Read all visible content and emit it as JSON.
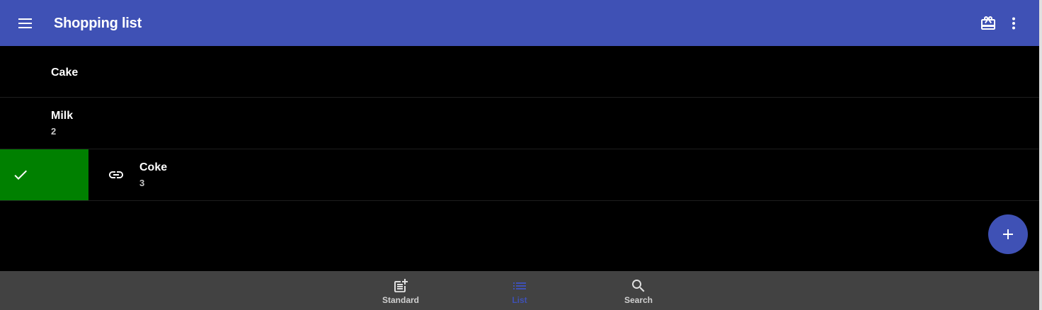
{
  "appbar": {
    "title": "Shopping list",
    "menu_icon": "menu-icon",
    "gift_icon": "redeem-icon",
    "more_icon": "more-vert-icon"
  },
  "items": [
    {
      "name": "Cake",
      "quantity": ""
    },
    {
      "name": "Milk",
      "quantity": "2"
    },
    {
      "name": "Coke",
      "quantity": "3",
      "icon": "link-icon",
      "swipe_action": "check-icon"
    }
  ],
  "bottom_nav": [
    {
      "label": "Standard",
      "icon": "post-add-icon",
      "active": false
    },
    {
      "label": "List",
      "icon": "list-icon",
      "active": true
    },
    {
      "label": "Search",
      "icon": "search-icon",
      "active": false
    }
  ],
  "colors": {
    "primary": "#3f51b5",
    "swipe_done": "#008000",
    "background": "#000000",
    "bottom_nav": "#424242"
  }
}
